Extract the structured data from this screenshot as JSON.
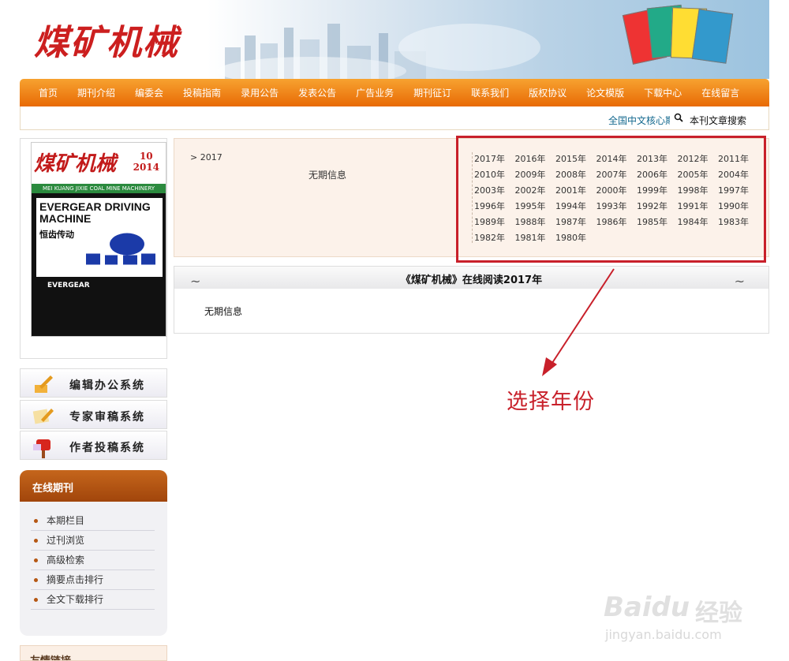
{
  "header": {
    "logo_text": "煤矿机械"
  },
  "nav": {
    "items": [
      "首页",
      "期刊介绍",
      "编委会",
      "投稿指南",
      "录用公告",
      "发表公告",
      "广告业务",
      "期刊征订",
      "联系我们",
      "版权协议",
      "论文模版",
      "下载中心",
      "在线留言"
    ]
  },
  "subbar": {
    "marquee": "全国中文核心期刊",
    "search_label": "本刊文章搜索"
  },
  "cover": {
    "title": "煤矿机械",
    "issue": "10",
    "year": "2014",
    "band": "MEI KUANG JIXIE COAL MINE MACHINERY",
    "ad_title": "EVERGEAR DRIVING MACHINE",
    "ad_cn": "恒齿传动",
    "brand": "EVERGEAR"
  },
  "systems": [
    {
      "label": "编辑办公系统",
      "icon": "pen-icon"
    },
    {
      "label": "专家审稿系统",
      "icon": "review-icon"
    },
    {
      "label": "作者投稿系统",
      "icon": "mailbox-icon"
    }
  ],
  "online_panel": {
    "title": "在线期刊",
    "items": [
      "本期栏目",
      "过刊浏览",
      "高级检索",
      "摘要点击排行",
      "全文下载排行"
    ]
  },
  "friends": {
    "title": "友情链接"
  },
  "archive": {
    "crumb": "2017",
    "no_info": "无期信息",
    "years": [
      "2017年",
      "2016年",
      "2015年",
      "2014年",
      "2013年",
      "2012年",
      "2011年",
      "2010年",
      "2009年",
      "2008年",
      "2007年",
      "2006年",
      "2005年",
      "2004年",
      "2003年",
      "2002年",
      "2001年",
      "2000年",
      "1999年",
      "1998年",
      "1997年",
      "1996年",
      "1995年",
      "1994年",
      "1993年",
      "1992年",
      "1991年",
      "1990年",
      "1989年",
      "1988年",
      "1987年",
      "1986年",
      "1985年",
      "1984年",
      "1983年",
      "1982年",
      "1981年",
      "1980年"
    ]
  },
  "reader": {
    "title": "《煤矿机械》在线阅读2017年",
    "no_info": "无期信息"
  },
  "annotation": {
    "text": "选择年份",
    "color": "#c8202a"
  },
  "watermark": {
    "brand": "Baidu",
    "cn": "经验",
    "url": "jingyan.baidu.com"
  },
  "colors": {
    "nav_orange": "#e86a05",
    "panel_brown": "#a1450b",
    "logo_red": "#cc1f1f"
  }
}
